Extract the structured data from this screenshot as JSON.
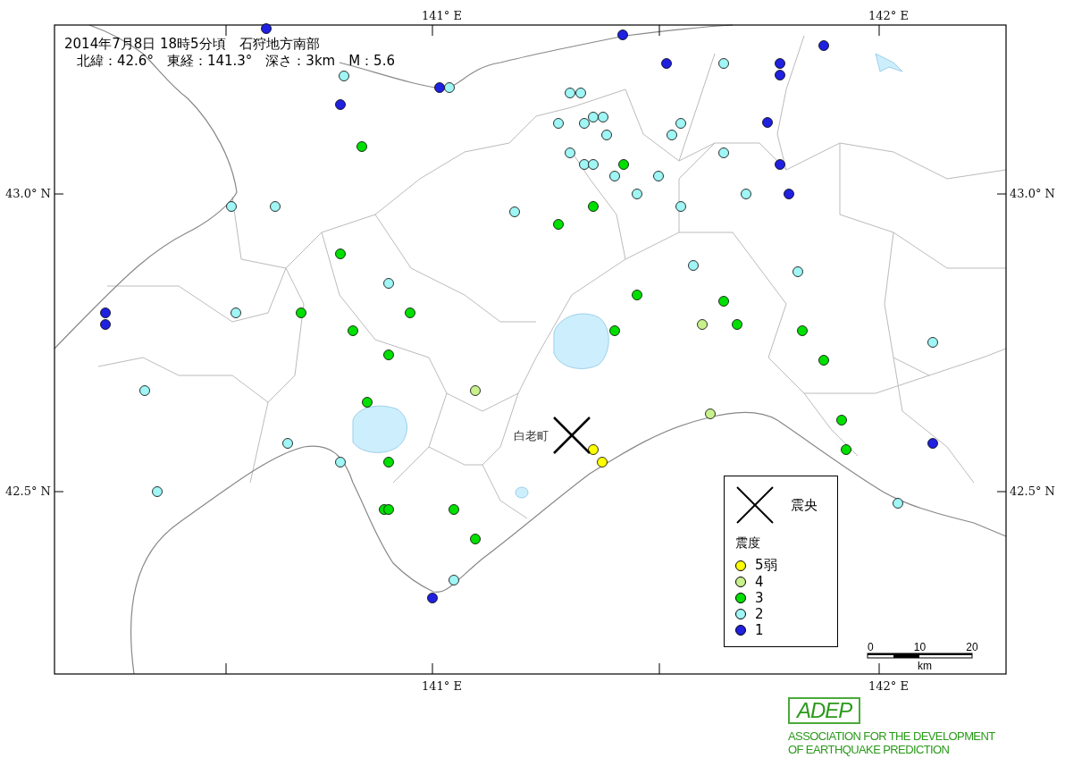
{
  "header": {
    "lines": [
      "2014年7月8日 18時5分頃　石狩地方南部",
      "北緯：42.6°　東経：141.3°　深さ：3km　M：5.6"
    ]
  },
  "map": {
    "axis_labels": {
      "top": [
        "141° E",
        "142° E"
      ],
      "bottom": [
        "141° E",
        "142° E"
      ],
      "left": [
        "43.0° N",
        "42.5° N"
      ],
      "right": [
        "43.0° N",
        "42.5° N"
      ]
    },
    "place_label": "白老町",
    "stations": [
      {
        "color": "#2020e0"
      },
      {
        "color": "#2020e0"
      },
      {
        "color": "#2020e0"
      },
      {
        "color": "#2020e0"
      },
      {
        "color": "#2020e0"
      },
      {
        "color": "#2020e0"
      },
      {
        "color": "#2020e0"
      },
      {
        "color": "#2020e0"
      },
      {
        "color": "#2020e0"
      },
      {
        "color": "#2020e0"
      },
      {
        "color": "#2020e0"
      },
      {
        "color": "#2020e0"
      },
      {
        "color": "#2020e0"
      },
      {
        "color": "#2020e0"
      },
      {
        "color": "#2020e0"
      },
      {
        "color": "#a0f5f5"
      },
      {
        "color": "#a0f5f5"
      },
      {
        "color": "#a0f5f5"
      },
      {
        "color": "#a0f5f5"
      },
      {
        "color": "#a0f5f5"
      },
      {
        "color": "#a0f5f5"
      },
      {
        "color": "#a0f5f5"
      },
      {
        "color": "#a0f5f5"
      },
      {
        "color": "#a0f5f5"
      },
      {
        "color": "#a0f5f5"
      },
      {
        "color": "#a0f5f5"
      },
      {
        "color": "#a0f5f5"
      },
      {
        "color": "#a0f5f5"
      },
      {
        "color": "#a0f5f5"
      },
      {
        "color": "#a0f5f5"
      },
      {
        "color": "#a0f5f5"
      },
      {
        "color": "#a0f5f5"
      },
      {
        "color": "#a0f5f5"
      },
      {
        "color": "#a0f5f5"
      },
      {
        "color": "#a0f5f5"
      },
      {
        "color": "#a0f5f5"
      },
      {
        "color": "#a0f5f5"
      },
      {
        "color": "#a0f5f5"
      },
      {
        "color": "#a0f5f5"
      },
      {
        "color": "#a0f5f5"
      },
      {
        "color": "#a0f5f5"
      },
      {
        "color": "#a0f5f5"
      },
      {
        "color": "#a0f5f5"
      },
      {
        "color": "#a0f5f5"
      },
      {
        "color": "#a0f5f5"
      },
      {
        "color": "#a0f5f5"
      },
      {
        "color": "#a0f5f5"
      },
      {
        "color": "#a0f5f5"
      },
      {
        "color": "#a0f5f5"
      },
      {
        "color": "#a0f5f5"
      },
      {
        "color": "#00e000"
      },
      {
        "color": "#00e000"
      },
      {
        "color": "#00e000"
      },
      {
        "color": "#00e000"
      },
      {
        "color": "#00e000"
      },
      {
        "color": "#00e000"
      },
      {
        "color": "#00e000"
      },
      {
        "color": "#00e000"
      },
      {
        "color": "#00e000"
      },
      {
        "color": "#00e000"
      },
      {
        "color": "#00e000"
      },
      {
        "color": "#00e000"
      },
      {
        "color": "#00e000"
      },
      {
        "color": "#00e000"
      },
      {
        "color": "#00e000"
      },
      {
        "color": "#00e000"
      },
      {
        "color": "#00e000"
      },
      {
        "color": "#00e000"
      },
      {
        "color": "#00e000"
      },
      {
        "color": "#00e000"
      },
      {
        "color": "#00e000"
      },
      {
        "color": "#00e000"
      },
      {
        "color": "#00e000"
      },
      {
        "color": "#c8f08c"
      },
      {
        "color": "#c8f08c"
      },
      {
        "color": "#c8f08c"
      },
      {
        "color": "#ffff00"
      },
      {
        "color": "#ffff00"
      }
    ],
    "legend": {
      "epicenter_label": "震央",
      "title": "震度",
      "items": [
        {
          "label": "5弱",
          "color": "#ffff00"
        },
        {
          "label": "4",
          "color": "#c8f08c"
        },
        {
          "label": "3",
          "color": "#00e000"
        },
        {
          "label": "2",
          "color": "#a0f5f5"
        },
        {
          "label": "1",
          "color": "#2020e0"
        }
      ]
    },
    "scale_bar": {
      "labels": [
        "0",
        "10",
        "20"
      ],
      "unit": "km"
    }
  },
  "logo": {
    "mark": "ADEP",
    "lines": [
      "ASSOCIATION FOR THE DEVELOPMENT",
      "OF EARTHQUAKE PREDICTION"
    ]
  }
}
